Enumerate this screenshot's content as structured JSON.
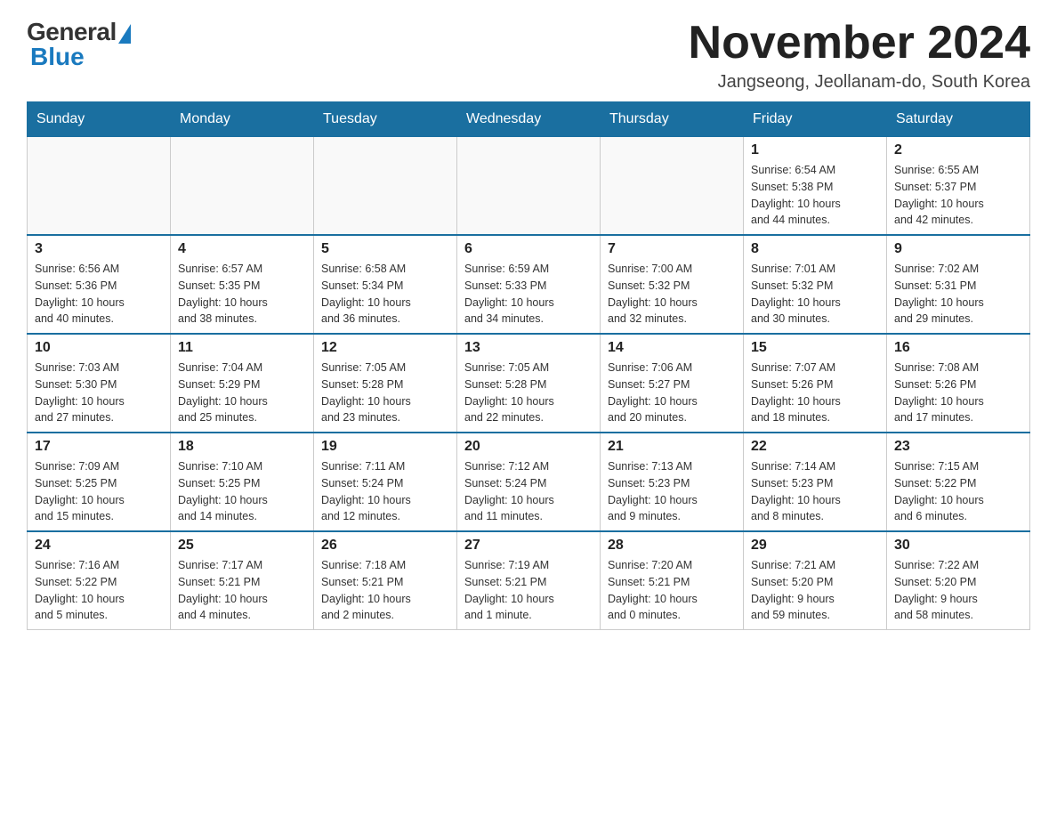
{
  "logo": {
    "general": "General",
    "blue": "Blue"
  },
  "title": "November 2024",
  "location": "Jangseong, Jeollanam-do, South Korea",
  "days_of_week": [
    "Sunday",
    "Monday",
    "Tuesday",
    "Wednesday",
    "Thursday",
    "Friday",
    "Saturday"
  ],
  "weeks": [
    [
      {
        "day": "",
        "info": ""
      },
      {
        "day": "",
        "info": ""
      },
      {
        "day": "",
        "info": ""
      },
      {
        "day": "",
        "info": ""
      },
      {
        "day": "",
        "info": ""
      },
      {
        "day": "1",
        "info": "Sunrise: 6:54 AM\nSunset: 5:38 PM\nDaylight: 10 hours\nand 44 minutes."
      },
      {
        "day": "2",
        "info": "Sunrise: 6:55 AM\nSunset: 5:37 PM\nDaylight: 10 hours\nand 42 minutes."
      }
    ],
    [
      {
        "day": "3",
        "info": "Sunrise: 6:56 AM\nSunset: 5:36 PM\nDaylight: 10 hours\nand 40 minutes."
      },
      {
        "day": "4",
        "info": "Sunrise: 6:57 AM\nSunset: 5:35 PM\nDaylight: 10 hours\nand 38 minutes."
      },
      {
        "day": "5",
        "info": "Sunrise: 6:58 AM\nSunset: 5:34 PM\nDaylight: 10 hours\nand 36 minutes."
      },
      {
        "day": "6",
        "info": "Sunrise: 6:59 AM\nSunset: 5:33 PM\nDaylight: 10 hours\nand 34 minutes."
      },
      {
        "day": "7",
        "info": "Sunrise: 7:00 AM\nSunset: 5:32 PM\nDaylight: 10 hours\nand 32 minutes."
      },
      {
        "day": "8",
        "info": "Sunrise: 7:01 AM\nSunset: 5:32 PM\nDaylight: 10 hours\nand 30 minutes."
      },
      {
        "day": "9",
        "info": "Sunrise: 7:02 AM\nSunset: 5:31 PM\nDaylight: 10 hours\nand 29 minutes."
      }
    ],
    [
      {
        "day": "10",
        "info": "Sunrise: 7:03 AM\nSunset: 5:30 PM\nDaylight: 10 hours\nand 27 minutes."
      },
      {
        "day": "11",
        "info": "Sunrise: 7:04 AM\nSunset: 5:29 PM\nDaylight: 10 hours\nand 25 minutes."
      },
      {
        "day": "12",
        "info": "Sunrise: 7:05 AM\nSunset: 5:28 PM\nDaylight: 10 hours\nand 23 minutes."
      },
      {
        "day": "13",
        "info": "Sunrise: 7:05 AM\nSunset: 5:28 PM\nDaylight: 10 hours\nand 22 minutes."
      },
      {
        "day": "14",
        "info": "Sunrise: 7:06 AM\nSunset: 5:27 PM\nDaylight: 10 hours\nand 20 minutes."
      },
      {
        "day": "15",
        "info": "Sunrise: 7:07 AM\nSunset: 5:26 PM\nDaylight: 10 hours\nand 18 minutes."
      },
      {
        "day": "16",
        "info": "Sunrise: 7:08 AM\nSunset: 5:26 PM\nDaylight: 10 hours\nand 17 minutes."
      }
    ],
    [
      {
        "day": "17",
        "info": "Sunrise: 7:09 AM\nSunset: 5:25 PM\nDaylight: 10 hours\nand 15 minutes."
      },
      {
        "day": "18",
        "info": "Sunrise: 7:10 AM\nSunset: 5:25 PM\nDaylight: 10 hours\nand 14 minutes."
      },
      {
        "day": "19",
        "info": "Sunrise: 7:11 AM\nSunset: 5:24 PM\nDaylight: 10 hours\nand 12 minutes."
      },
      {
        "day": "20",
        "info": "Sunrise: 7:12 AM\nSunset: 5:24 PM\nDaylight: 10 hours\nand 11 minutes."
      },
      {
        "day": "21",
        "info": "Sunrise: 7:13 AM\nSunset: 5:23 PM\nDaylight: 10 hours\nand 9 minutes."
      },
      {
        "day": "22",
        "info": "Sunrise: 7:14 AM\nSunset: 5:23 PM\nDaylight: 10 hours\nand 8 minutes."
      },
      {
        "day": "23",
        "info": "Sunrise: 7:15 AM\nSunset: 5:22 PM\nDaylight: 10 hours\nand 6 minutes."
      }
    ],
    [
      {
        "day": "24",
        "info": "Sunrise: 7:16 AM\nSunset: 5:22 PM\nDaylight: 10 hours\nand 5 minutes."
      },
      {
        "day": "25",
        "info": "Sunrise: 7:17 AM\nSunset: 5:21 PM\nDaylight: 10 hours\nand 4 minutes."
      },
      {
        "day": "26",
        "info": "Sunrise: 7:18 AM\nSunset: 5:21 PM\nDaylight: 10 hours\nand 2 minutes."
      },
      {
        "day": "27",
        "info": "Sunrise: 7:19 AM\nSunset: 5:21 PM\nDaylight: 10 hours\nand 1 minute."
      },
      {
        "day": "28",
        "info": "Sunrise: 7:20 AM\nSunset: 5:21 PM\nDaylight: 10 hours\nand 0 minutes."
      },
      {
        "day": "29",
        "info": "Sunrise: 7:21 AM\nSunset: 5:20 PM\nDaylight: 9 hours\nand 59 minutes."
      },
      {
        "day": "30",
        "info": "Sunrise: 7:22 AM\nSunset: 5:20 PM\nDaylight: 9 hours\nand 58 minutes."
      }
    ]
  ]
}
